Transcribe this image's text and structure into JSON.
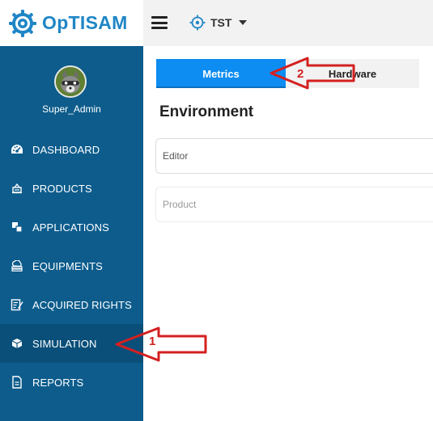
{
  "header": {
    "brand": "OpTISAM",
    "env_name": "TST",
    "icons": {
      "logo": "gear-logo-icon",
      "menu": "hamburger-icon",
      "env": "crosshair-icon",
      "caret": "caret-down-icon"
    }
  },
  "sidebar": {
    "user": "Super_Admin",
    "items": [
      {
        "label": "DASHBOARD",
        "icon": "dashboard-icon"
      },
      {
        "label": "PRODUCTS",
        "icon": "products-icon"
      },
      {
        "label": "APPLICATIONS",
        "icon": "applications-icon"
      },
      {
        "label": "EQUIPMENTS",
        "icon": "equipments-icon"
      },
      {
        "label": "ACQUIRED RIGHTS",
        "icon": "acquired-rights-icon"
      },
      {
        "label": "SIMULATION",
        "icon": "simulation-icon"
      },
      {
        "label": "REPORTS",
        "icon": "reports-icon"
      }
    ],
    "active_item": "SIMULATION"
  },
  "main": {
    "tabs": [
      {
        "label": "Metrics",
        "active": true
      },
      {
        "label": "Hardware",
        "active": false
      }
    ],
    "section_title": "Environment",
    "fields": {
      "editor_label": "Editor",
      "product_label": "Product"
    }
  },
  "annotations": [
    {
      "number": "1",
      "target": "SIMULATION"
    },
    {
      "number": "2",
      "target": "Metrics"
    }
  ],
  "colors": {
    "brand": "#1f86c6",
    "sidebar": "#0d5c8c",
    "sidebar_active": "#0a4f79",
    "tab_active": "#0d8cf2",
    "annotation": "#d42020"
  }
}
